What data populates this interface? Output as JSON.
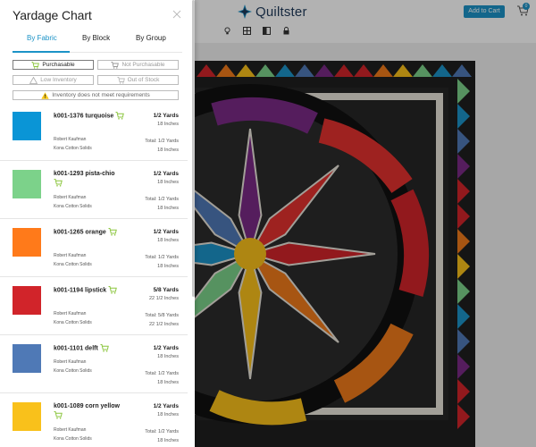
{
  "app": {
    "brand": "Quiltster",
    "add_to_cart": "Add to Cart",
    "cart_count": "0",
    "toolbar_icons": [
      "lightbulb-icon",
      "grid-icon",
      "contrast-icon",
      "lock-icon"
    ]
  },
  "panel": {
    "title": "Yardage Chart",
    "tabs": [
      "By Fabric",
      "By Block",
      "By Group"
    ],
    "active_tab": "By Fabric",
    "filters": {
      "purchasable": "Purchasable",
      "not_purchasable": "Not Purchasable",
      "low_inventory": "Low Inventory",
      "out_of_stock": "Out of Stock",
      "inventory_warning": "Inventory does not meet requirements"
    }
  },
  "fabrics": [
    {
      "name": "k001-1376 turquoise",
      "color": "#0a95d6",
      "maker": "Robert Kaufman",
      "line": "Kona Cotton Solids",
      "yards": "1/2 Yards",
      "inches": "18 Inches",
      "total_yards": "Total: 1/2 Yards",
      "total_inches": "18 Inches"
    },
    {
      "name": "k001-1293 pista-chio",
      "color": "#7cd28a",
      "maker": "Robert Kaufman",
      "line": "Kona Cotton Solids",
      "yards": "1/2 Yards",
      "inches": "18 Inches",
      "total_yards": "Total: 1/2 Yards",
      "total_inches": "18 Inches"
    },
    {
      "name": "k001-1265 orange",
      "color": "#ff7a1a",
      "maker": "Robert Kaufman",
      "line": "Kona Cotton Solids",
      "yards": "1/2 Yards",
      "inches": "18 Inches",
      "total_yards": "Total: 1/2 Yards",
      "total_inches": "18 Inches"
    },
    {
      "name": "k001-1194 lipstick",
      "color": "#d1242a",
      "maker": "Robert Kaufman",
      "line": "Kona Cotton Solids",
      "yards": "5/8 Yards",
      "inches": "22 1/2 Inches",
      "total_yards": "Total: 5/8 Yards",
      "total_inches": "22 1/2 Inches"
    },
    {
      "name": "k001-1101 delft",
      "color": "#4f79b6",
      "maker": "Robert Kaufman",
      "line": "Kona Cotton Solids",
      "yards": "1/2 Yards",
      "inches": "18 Inches",
      "total_yards": "Total: 1/2 Yards",
      "total_inches": "18 Inches"
    },
    {
      "name": "k001-1089 corn yellow",
      "color": "#f9c11b",
      "maker": "Robert Kaufman",
      "line": "Kona Cotton Solids",
      "yards": "1/2 Yards",
      "inches": "18 Inches",
      "total_yards": "Total: 1/2 Yards",
      "total_inches": "18 Inches"
    }
  ],
  "colors": {
    "accent": "#1c93c7",
    "cart_green": "#8cc63f",
    "warning": "#f5c518"
  }
}
